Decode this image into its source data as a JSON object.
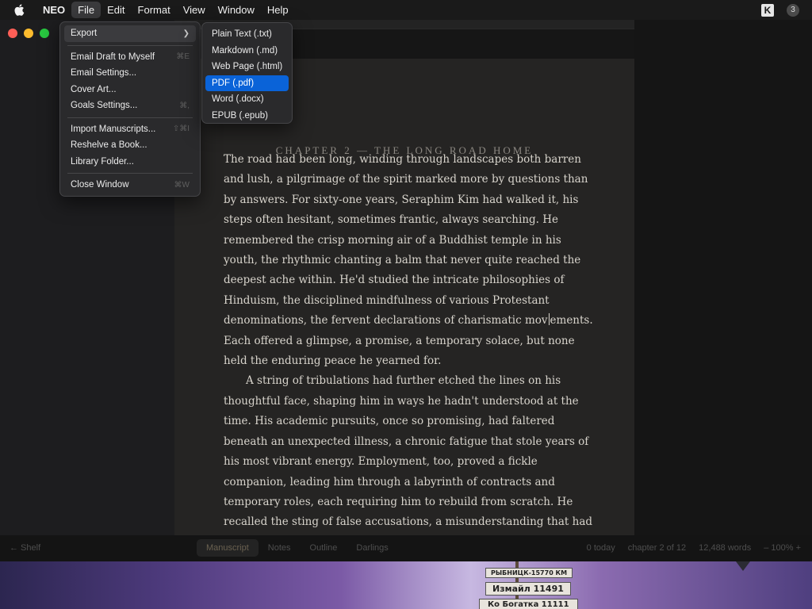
{
  "menubar": {
    "app_name": "NEO",
    "items": [
      "File",
      "Edit",
      "Format",
      "View",
      "Window",
      "Help"
    ],
    "badge_count": "3"
  },
  "file_menu": {
    "export_label": "Export",
    "items": [
      {
        "label": "Email Draft to Myself",
        "shortcut": "⌘E"
      },
      {
        "label": "Email Settings...",
        "shortcut": ""
      },
      {
        "label": "Cover Art...",
        "shortcut": ""
      },
      {
        "label": "Goals  Settings...",
        "shortcut": "⌘,"
      },
      {
        "label": "Import Manuscripts...",
        "shortcut": "⇧⌘I"
      },
      {
        "label": "Reshelve a Book...",
        "shortcut": ""
      },
      {
        "label": "Library Folder...",
        "shortcut": ""
      },
      {
        "label": "Close Window",
        "shortcut": "⌘W"
      }
    ]
  },
  "export_menu": {
    "items": [
      "Plain Text (.txt)",
      "Markdown (.md)",
      "Web Page (.html)",
      "PDF (.pdf)",
      "Word (.docx)",
      "EPUB (.epub)"
    ],
    "selected_index": 3
  },
  "document": {
    "chapter_title": "CHAPTER 2 — THE LONG ROAD HOME",
    "para1_before_cursor": "The road had been long, winding through landscapes both barren and lush, a pilgrimage of the spirit marked more by questions than by answers. For sixty-one years, Seraphim Kim had walked it, his steps often hesitant, sometimes frantic, always searching. He remembered the crisp morning air of a Buddhist temple in his youth, the rhythmic chanting a balm that never quite reached the deepest ache within. He'd studied the intricate philosophies of Hinduism, the disciplined mindfulness of various Protestant denominations, the fervent declarations of charismatic mov",
    "para1_after_cursor": "ements. Each offered a glimpse, a promise, a temporary solace, but none held the enduring peace he yearned for.",
    "para2": "A string of tribulations had further etched the lines on his thoughtful face, shaping him in ways he hadn't understood at the time. His academic pursuits, once so promising, had faltered beneath an unexpected illness, a chronic fatigue that stole years of his most vibrant energy. Employment, too, proved a fickle companion, leading him through a labyrinth of contracts and temporary roles, each requiring him to rebuild from scratch. He recalled the sting of false accusations, a misunderstanding that had threatened to unravel his reputation,"
  },
  "statusbar": {
    "shelf_label": "← Shelf",
    "tabs": [
      "Manuscript",
      "Notes",
      "Outline",
      "Darlings"
    ],
    "active_tab": "Manuscript",
    "today": "0 today",
    "chapter": "chapter 2 of 12",
    "words": "12,488 words",
    "zoom": "–  100%  +"
  },
  "desktop": {
    "sign_texts": [
      "РЫБНИЦК-15770 КМ",
      "Измайл 11491",
      "Ко Богатка 11111"
    ]
  }
}
